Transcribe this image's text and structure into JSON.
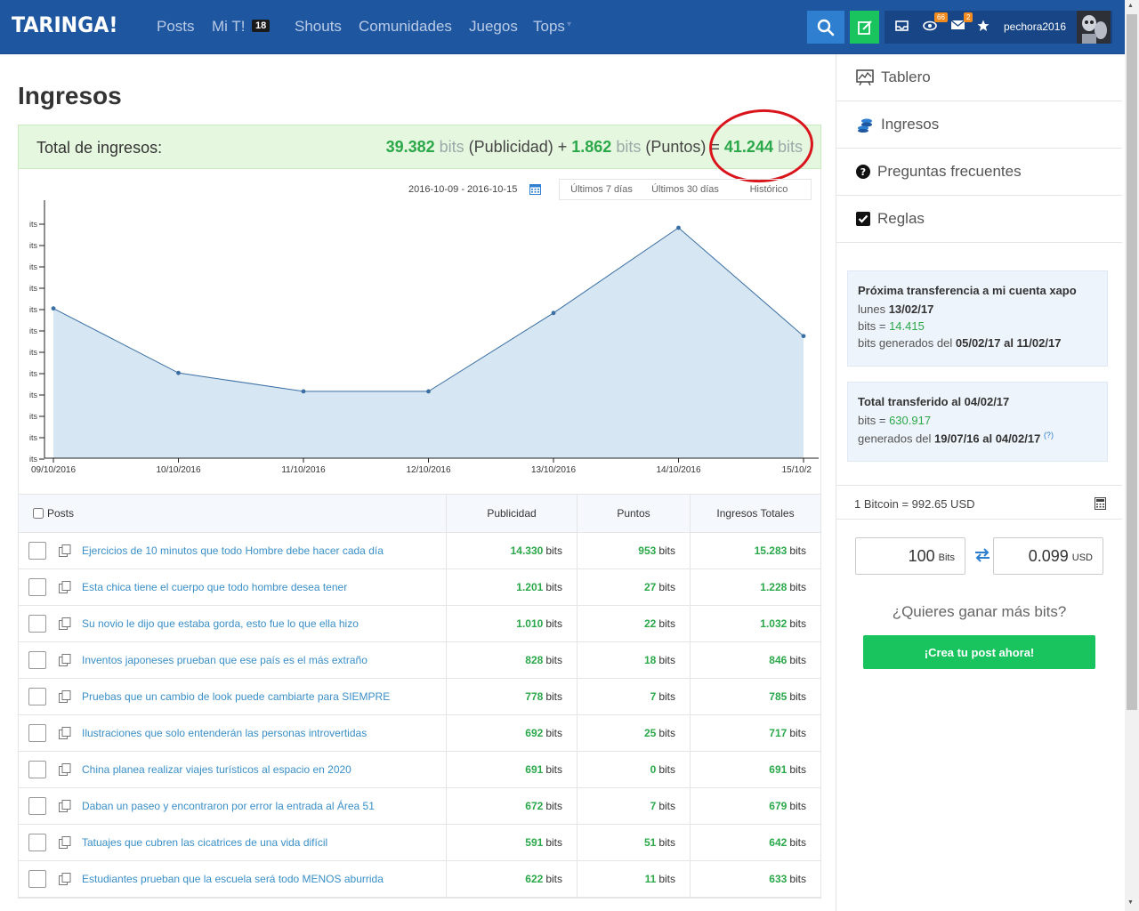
{
  "navbar": {
    "logo": "TARINGA!",
    "links": [
      "Posts",
      "Mi T!",
      "Shouts",
      "Comunidades",
      "Juegos",
      "Tops"
    ],
    "mit_badge": "18",
    "badge_views": "66",
    "badge_messages": "2",
    "username": "pechora2016"
  },
  "page": {
    "title": "Ingresos"
  },
  "totals": {
    "label": "Total de ingresos:",
    "publicidad_value": "39.382",
    "publicidad_unit": "bits",
    "publicidad_label": "(Publicidad) +",
    "puntos_value": "1.862",
    "puntos_unit": "bits",
    "puntos_label": "(Puntos) =",
    "total_value": "41.244",
    "total_unit": "bits"
  },
  "range": {
    "date_range": "2016-10-09 - 2016-10-15",
    "buttons": [
      "Últimos 7 días",
      "Últimos 30 días",
      "Histórico"
    ]
  },
  "chart_data": {
    "type": "area",
    "title": "",
    "xlabel": "",
    "ylabel": "",
    "x": [
      "09/10/2016",
      "10/10/2016",
      "11/10/2016",
      "12/10/2016",
      "13/10/2016",
      "14/10/2016",
      "15/10/2"
    ],
    "y_relative_0_to_1": [
      0.65,
      0.37,
      0.29,
      0.29,
      0.63,
      1.0,
      0.53
    ],
    "ytick_label": "its",
    "ytick_count": 12,
    "grid": false,
    "fill_color": "#d6e6f3",
    "line_color": "#3b6fa3"
  },
  "table": {
    "headers": [
      "Posts",
      "Publicidad",
      "Puntos",
      "Ingresos Totales"
    ],
    "unit": "bits",
    "rows": [
      {
        "title": "Ejercicios de 10 minutos que todo Hombre debe hacer cada día",
        "publicidad": "14.330",
        "puntos": "953",
        "total": "15.283"
      },
      {
        "title": "Esta chica tiene el cuerpo que todo hombre desea tener",
        "publicidad": "1.201",
        "puntos": "27",
        "total": "1.228"
      },
      {
        "title": "Su novio le dijo que estaba gorda, esto fue lo que ella hizo",
        "publicidad": "1.010",
        "puntos": "22",
        "total": "1.032"
      },
      {
        "title": "Inventos japoneses prueban que ese país es el más extraño",
        "publicidad": "828",
        "puntos": "18",
        "total": "846"
      },
      {
        "title": "Pruebas que un cambio de look puede cambiarte para SIEMPRE",
        "publicidad": "778",
        "puntos": "7",
        "total": "785"
      },
      {
        "title": "Ilustraciones que solo entenderán las personas introvertidas",
        "publicidad": "692",
        "puntos": "25",
        "total": "717"
      },
      {
        "title": "China planea realizar viajes turísticos al espacio en 2020",
        "publicidad": "691",
        "puntos": "0",
        "total": "691"
      },
      {
        "title": "Daban un paseo y encontraron por error la entrada al Área 51",
        "publicidad": "672",
        "puntos": "7",
        "total": "679"
      },
      {
        "title": "Tatuajes que cubren las cicatrices de una vida difícil",
        "publicidad": "591",
        "puntos": "51",
        "total": "642"
      },
      {
        "title": "Estudiantes prueban que la escuela será todo MENOS aburrida",
        "publicidad": "622",
        "puntos": "11",
        "total": "633"
      }
    ]
  },
  "sidebar": {
    "items": [
      "Tablero",
      "Ingresos",
      "Preguntas frecuentes",
      "Reglas"
    ],
    "next_transfer": {
      "heading": "Próxima transferencia a mi cuenta xapo",
      "day_prefix": "lunes",
      "date": "13/02/17",
      "bits_prefix": "bits =",
      "bits": "14.415",
      "generated_prefix": "bits generados del",
      "generated_range": "05/02/17 al 11/02/17"
    },
    "total_transfer": {
      "heading": "Total transferido al 04/02/17",
      "bits_prefix": "bits =",
      "bits": "630.917",
      "generated_prefix": "generados del",
      "generated_range": "19/07/16 al 04/02/17",
      "help": "(?)"
    },
    "rate": "1 Bitcoin = 992.65 USD",
    "converter": {
      "bits_value": "100",
      "bits_unit": "Bits",
      "usd_value": "0.099",
      "usd_unit": "USD"
    },
    "more_bits": "¿Quieres ganar más bits?",
    "cta": "¡Crea tu post ahora!"
  }
}
